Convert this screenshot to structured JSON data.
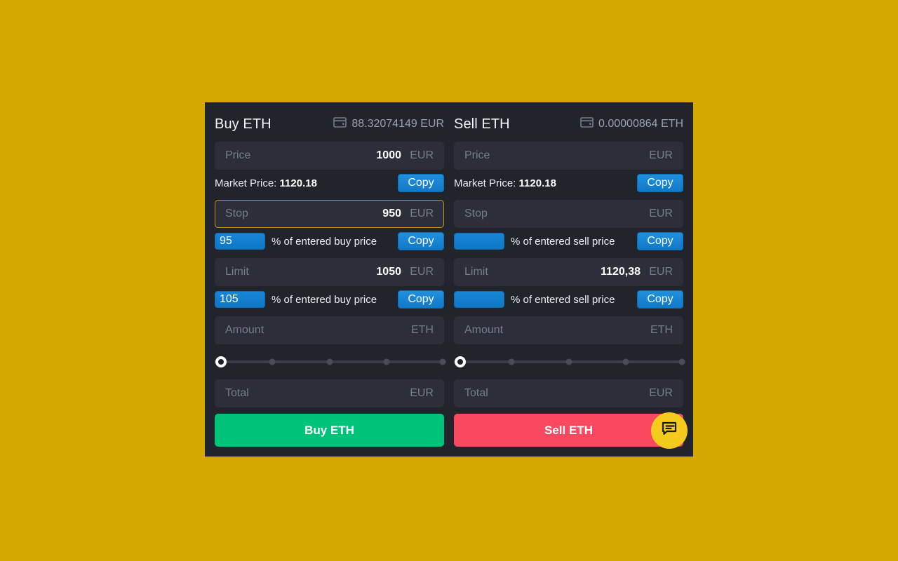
{
  "background_color": "#d5a800",
  "card_background": "#22242c",
  "colors": {
    "accent_blue": "#1279c6",
    "buy_green": "#00c37a",
    "sell_red": "#f9485f",
    "focus_gold": "#c8960c",
    "chat_yellow": "#f5cc1d",
    "field_bg": "#2c2f39",
    "muted_text": "#767d8b"
  },
  "buy": {
    "title": "Buy ETH",
    "wallet_icon": "wallet-icon",
    "balance": "88.32074149 EUR",
    "price": {
      "label": "Price",
      "value": "1000",
      "unit": "EUR",
      "market_prefix": "Market Price: ",
      "market_price": "1120.18",
      "copy_label": "Copy"
    },
    "stop": {
      "label": "Stop",
      "value": "950",
      "unit": "EUR",
      "focused": true,
      "pct_value": "95",
      "pct_caption": "% of entered buy price",
      "copy_label": "Copy"
    },
    "limit": {
      "label": "Limit",
      "value": "1050",
      "unit": "EUR",
      "pct_value": "105",
      "pct_caption": "% of entered buy price",
      "copy_label": "Copy"
    },
    "amount": {
      "label": "Amount",
      "value": "",
      "unit": "ETH"
    },
    "slider": {
      "value": 0,
      "min": 0,
      "max": 100,
      "ticks": [
        25,
        50,
        75,
        100
      ]
    },
    "total": {
      "label": "Total",
      "value": "",
      "unit": "EUR"
    },
    "action_label": "Buy ETH"
  },
  "sell": {
    "title": "Sell ETH",
    "wallet_icon": "wallet-icon",
    "balance": "0.00000864 ETH",
    "price": {
      "label": "Price",
      "value": "",
      "unit": "EUR",
      "market_prefix": "Market Price: ",
      "market_price": "1120.18",
      "copy_label": "Copy"
    },
    "stop": {
      "label": "Stop",
      "value": "",
      "unit": "EUR",
      "focused": false,
      "pct_value": "",
      "pct_caption": "% of entered sell price",
      "copy_label": "Copy"
    },
    "limit": {
      "label": "Limit",
      "value": "1120,38",
      "unit": "EUR",
      "pct_value": "",
      "pct_caption": "% of entered sell price",
      "copy_label": "Copy"
    },
    "amount": {
      "label": "Amount",
      "value": "",
      "unit": "ETH"
    },
    "slider": {
      "value": 0,
      "min": 0,
      "max": 100,
      "ticks": [
        25,
        50,
        75,
        100
      ]
    },
    "total": {
      "label": "Total",
      "value": "",
      "unit": "EUR"
    },
    "action_label": "Sell ETH",
    "chat_icon": "chat-bubble-icon"
  }
}
